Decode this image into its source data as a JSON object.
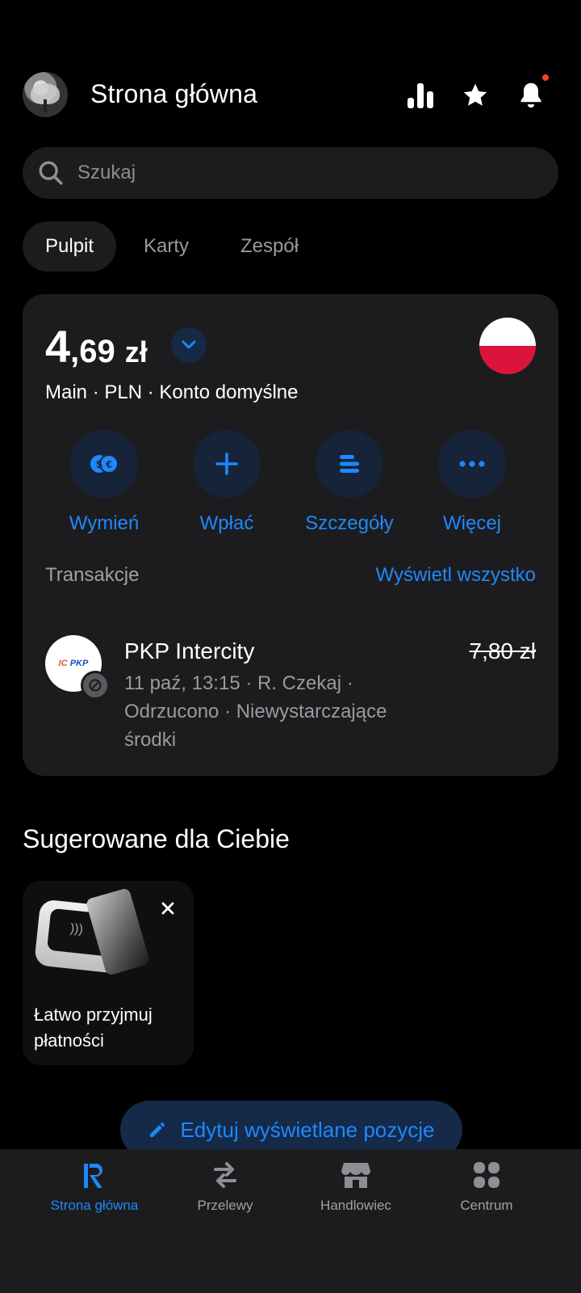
{
  "header": {
    "title": "Strona główna"
  },
  "search": {
    "placeholder": "Szukaj"
  },
  "tabs": [
    {
      "label": "Pulpit",
      "active": true
    },
    {
      "label": "Karty",
      "active": false
    },
    {
      "label": "Zespół",
      "active": false
    }
  ],
  "account": {
    "balance_int": "4",
    "balance_dec": ",69",
    "currency": "zł",
    "subtitle": "Main · PLN · Konto domyślne",
    "flag": "poland-flag"
  },
  "actions": [
    {
      "label": "Wymień",
      "icon": "exchange-icon"
    },
    {
      "label": "Wpłać",
      "icon": "plus-icon"
    },
    {
      "label": "Szczegóły",
      "icon": "details-icon"
    },
    {
      "label": "Więcej",
      "icon": "more-icon"
    }
  ],
  "transactions": {
    "title": "Transakcje",
    "see_all": "Wyświetl wszystko",
    "items": [
      {
        "merchant": "PKP Intercity",
        "amount": "7,80 zł",
        "meta": "11 paź, 13:15 · R. Czekaj · Odrzucono · Niewystarczające środki"
      }
    ]
  },
  "suggested": {
    "title": "Sugerowane dla Ciebie",
    "cards": [
      {
        "text": "Łatwo przyjmuj płatności"
      }
    ]
  },
  "edit_button": {
    "label": "Edytuj wyświetlane pozycje"
  },
  "bottom_nav": [
    {
      "label": "Strona główna",
      "icon": "revolut-r-icon",
      "active": true
    },
    {
      "label": "Przelewy",
      "icon": "transfer-icon",
      "active": false
    },
    {
      "label": "Handlowiec",
      "icon": "store-icon",
      "active": false
    },
    {
      "label": "Centrum",
      "icon": "apps-grid-icon",
      "active": false
    }
  ],
  "colors": {
    "accent": "#1e88ff",
    "background": "#000000",
    "surface": "#1c1c1e",
    "notification": "#ff3b30"
  }
}
